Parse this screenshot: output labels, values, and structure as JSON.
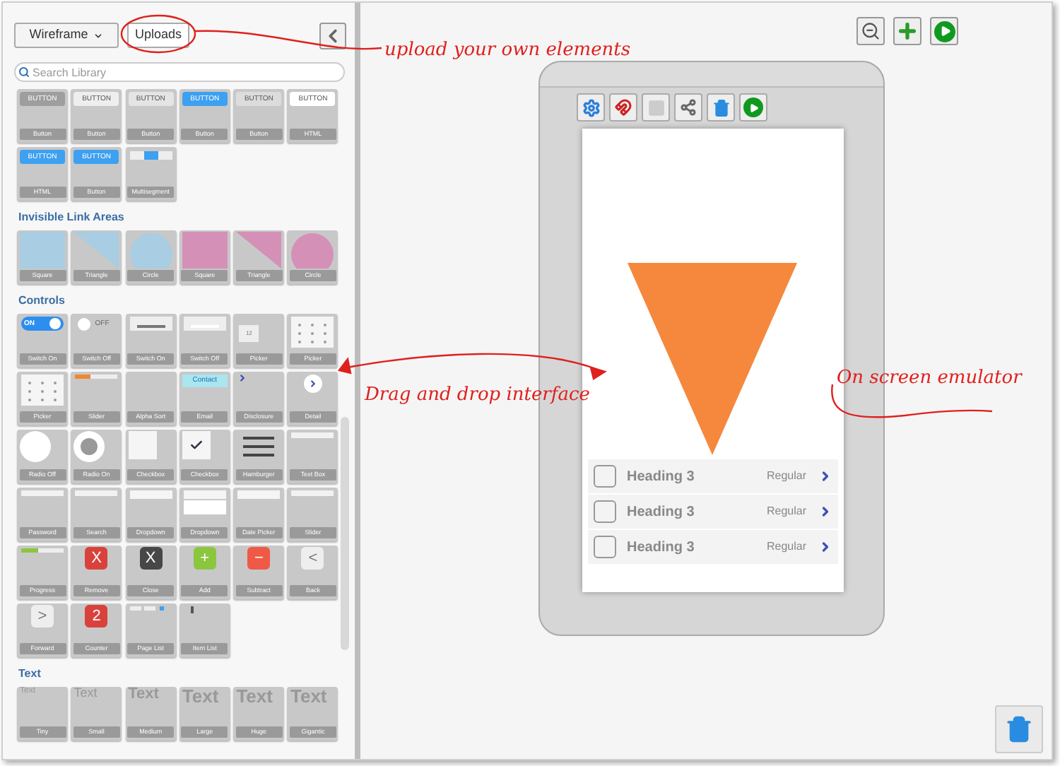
{
  "library": {
    "mode_menu": "Wireframe",
    "uploads_button": "Uploads",
    "search": {
      "placeholder": "Search Library"
    },
    "sections": [
      {
        "tiles": [
          {
            "label": "Button",
            "kind": "button",
            "preview": "BUTTON",
            "color": "#9e9e9e"
          },
          {
            "label": "Button",
            "kind": "button",
            "preview": "BUTTON",
            "color": "#eeeeee"
          },
          {
            "label": "Button",
            "kind": "button",
            "preview": "BUTTON",
            "color": "#e4e4e4"
          },
          {
            "label": "Button",
            "kind": "button",
            "preview": "BUTTON",
            "color": "#3ea0f0"
          },
          {
            "label": "Button",
            "kind": "button",
            "preview": "BUTTON",
            "color": "#dcdcdc"
          },
          {
            "label": "HTML",
            "kind": "button",
            "preview": "BUTTON",
            "color": "#ffffff"
          },
          {
            "label": "HTML",
            "kind": "button",
            "preview": "BUTTON",
            "color": "#3ea0f0"
          },
          {
            "label": "Button",
            "kind": "button",
            "preview": "BUTTON",
            "color": "#3ea0f0"
          },
          {
            "label": "Multisegment",
            "kind": "segments"
          }
        ]
      },
      {
        "heading": "Invisible Link Areas",
        "tiles": [
          {
            "label": "Square",
            "kind": "square",
            "color": "#a9cde2"
          },
          {
            "label": "Triangle",
            "kind": "triangle",
            "color": "#a9cde2"
          },
          {
            "label": "Circle",
            "kind": "circle",
            "color": "#a9cde2"
          },
          {
            "label": "Square",
            "kind": "square",
            "color": "#d590b8"
          },
          {
            "label": "Triangle",
            "kind": "triangle",
            "color": "#d590b8"
          },
          {
            "label": "Circle",
            "kind": "circle",
            "color": "#d590b8"
          }
        ]
      },
      {
        "heading": "Controls",
        "tiles": [
          {
            "label": "Switch On",
            "kind": "switch",
            "on": true,
            "preview": "ON"
          },
          {
            "label": "Switch Off",
            "kind": "switch",
            "on": false,
            "preview": "OFF"
          },
          {
            "label": "Switch On",
            "kind": "bar",
            "on": true
          },
          {
            "label": "Switch Off",
            "kind": "bar",
            "on": false
          },
          {
            "label": "Picker",
            "kind": "number",
            "preview": "12"
          },
          {
            "label": "Picker",
            "kind": "grid"
          },
          {
            "label": "Picker",
            "kind": "grid"
          },
          {
            "label": "Slider",
            "kind": "slider",
            "level": 0.35
          },
          {
            "label": "Alpha Sort",
            "kind": "blank"
          },
          {
            "label": "Email",
            "kind": "email",
            "preview": "Contact"
          },
          {
            "label": "Disclosure",
            "kind": "disclosure"
          },
          {
            "label": "Detail",
            "kind": "detail"
          },
          {
            "label": "Radio Off",
            "kind": "radio",
            "on": false
          },
          {
            "label": "Radio On",
            "kind": "radio",
            "on": true
          },
          {
            "label": "Checkbox",
            "kind": "checkbox",
            "on": false
          },
          {
            "label": "Checkbox",
            "kind": "checkbox",
            "on": true
          },
          {
            "label": "Hamburger",
            "kind": "hamburger"
          },
          {
            "label": "Text Box",
            "kind": "field"
          },
          {
            "label": "Password",
            "kind": "field"
          },
          {
            "label": "Search",
            "kind": "field"
          },
          {
            "label": "Dropdown",
            "kind": "dropdown",
            "on": false
          },
          {
            "label": "Dropdown",
            "kind": "dropdown",
            "on": true
          },
          {
            "label": "Date Picker",
            "kind": "dropdown",
            "on": false
          },
          {
            "label": "Slider",
            "kind": "field"
          },
          {
            "label": "Progress",
            "kind": "progress",
            "level": 0.4
          },
          {
            "label": "Remove",
            "kind": "badge",
            "preview": "X",
            "color": "#d9423c"
          },
          {
            "label": "Close",
            "kind": "badge",
            "preview": "X",
            "color": "#474747"
          },
          {
            "label": "Add",
            "kind": "badge",
            "preview": "+",
            "color": "#8cc63e"
          },
          {
            "label": "Subtract",
            "kind": "badge",
            "preview": "−",
            "color": "#ee5a45"
          },
          {
            "label": "Back",
            "kind": "badge",
            "preview": "<",
            "color": "#eeeeee"
          },
          {
            "label": "Forward",
            "kind": "badge",
            "preview": ">",
            "color": "#eeeeee"
          },
          {
            "label": "Counter",
            "kind": "badge",
            "preview": "2",
            "color": "#d9423c"
          },
          {
            "label": "Page List",
            "kind": "pagelist"
          },
          {
            "label": "Item List",
            "kind": "itemlist"
          }
        ]
      },
      {
        "heading": "Text",
        "tiles": [
          {
            "label": "Tiny",
            "kind": "text",
            "preview": "Text"
          },
          {
            "label": "Small",
            "kind": "text",
            "preview": "Text"
          },
          {
            "label": "Medium",
            "kind": "text",
            "preview": "Text"
          },
          {
            "label": "Large",
            "kind": "text",
            "preview": "Text"
          },
          {
            "label": "Huge",
            "kind": "text",
            "preview": "Text"
          },
          {
            "label": "Gigantic",
            "kind": "text",
            "preview": "Text"
          }
        ]
      }
    ]
  },
  "emulator": {
    "rows": [
      {
        "checked": false,
        "title": "Heading 3",
        "detail": "Regular"
      },
      {
        "checked": false,
        "title": "Heading 3",
        "detail": "Regular"
      },
      {
        "checked": false,
        "title": "Heading 3",
        "detail": "Regular"
      }
    ]
  },
  "annotations": [
    {
      "kind": "uploads",
      "text": "upload your own elements"
    },
    {
      "kind": "drag",
      "text": "Drag and drop interface"
    },
    {
      "kind": "emulator",
      "text": "On screen emulator"
    }
  ]
}
